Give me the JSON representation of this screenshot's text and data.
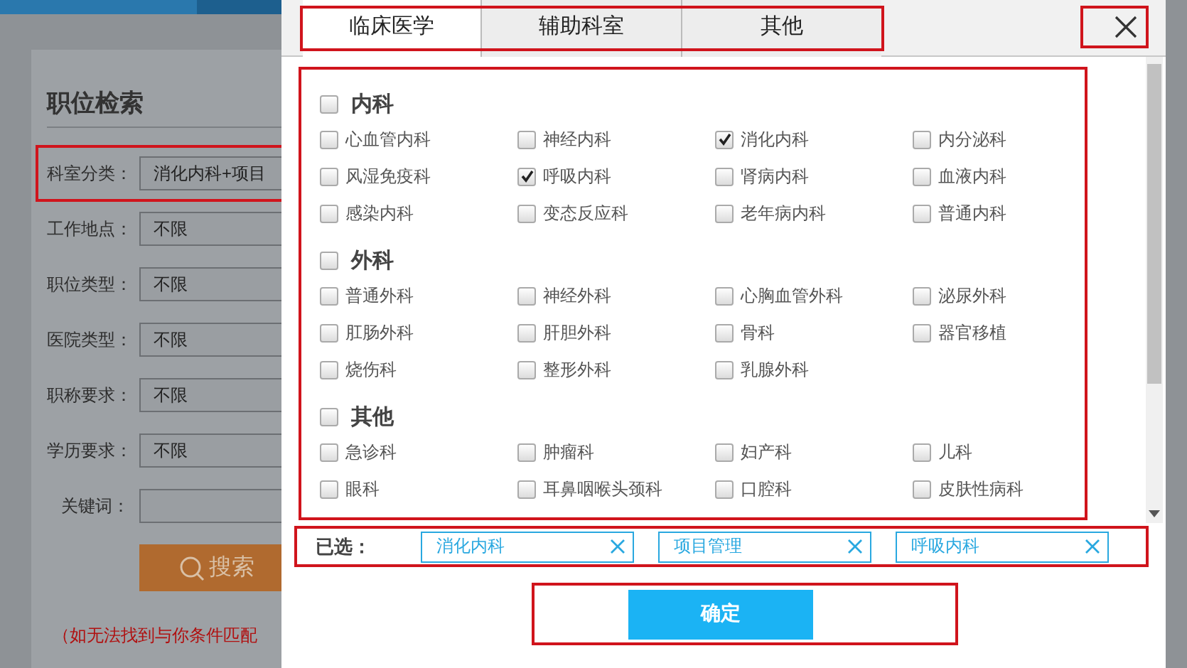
{
  "page": {
    "title": "职位检索",
    "fields": [
      {
        "label": "科室分类：",
        "value": "消化内科+项目"
      },
      {
        "label": "工作地点：",
        "value": "不限"
      },
      {
        "label": "职位类型：",
        "value": "不限"
      },
      {
        "label": "医院类型：",
        "value": "不限"
      },
      {
        "label": "职称要求：",
        "value": "不限"
      },
      {
        "label": "学历要求：",
        "value": "不限"
      },
      {
        "label": "关键词："
      }
    ],
    "search_button": "搜索",
    "note": "（如无法找到与你条件匹配"
  },
  "dialog": {
    "tabs": [
      {
        "label": "临床医学",
        "selected": true
      },
      {
        "label": "辅助科室",
        "selected": false
      },
      {
        "label": "其他",
        "selected": false
      }
    ],
    "groups": [
      {
        "title": "内科",
        "checked": false,
        "items": [
          {
            "label": "心血管内科",
            "checked": false
          },
          {
            "label": "神经内科",
            "checked": false
          },
          {
            "label": "消化内科",
            "checked": true
          },
          {
            "label": "内分泌科",
            "checked": false
          },
          {
            "label": "风湿免疫科",
            "checked": false
          },
          {
            "label": "呼吸内科",
            "checked": true
          },
          {
            "label": "肾病内科",
            "checked": false
          },
          {
            "label": "血液内科",
            "checked": false
          },
          {
            "label": "感染内科",
            "checked": false
          },
          {
            "label": "变态反应科",
            "checked": false
          },
          {
            "label": "老年病内科",
            "checked": false
          },
          {
            "label": "普通内科",
            "checked": false
          }
        ]
      },
      {
        "title": "外科",
        "checked": false,
        "items": [
          {
            "label": "普通外科",
            "checked": false
          },
          {
            "label": "神经外科",
            "checked": false
          },
          {
            "label": "心胸血管外科",
            "checked": false
          },
          {
            "label": "泌尿外科",
            "checked": false
          },
          {
            "label": "肛肠外科",
            "checked": false
          },
          {
            "label": "肝胆外科",
            "checked": false
          },
          {
            "label": "骨科",
            "checked": false
          },
          {
            "label": "器官移植",
            "checked": false
          },
          {
            "label": "烧伤科",
            "checked": false
          },
          {
            "label": "整形外科",
            "checked": false
          },
          {
            "label": "乳腺外科",
            "checked": false
          }
        ]
      },
      {
        "title": "其他",
        "checked": false,
        "items": [
          {
            "label": "急诊科",
            "checked": false
          },
          {
            "label": "肿瘤科",
            "checked": false
          },
          {
            "label": "妇产科",
            "checked": false
          },
          {
            "label": "儿科",
            "checked": false
          },
          {
            "label": "眼科",
            "checked": false
          },
          {
            "label": "耳鼻咽喉头颈科",
            "checked": false
          },
          {
            "label": "口腔科",
            "checked": false
          },
          {
            "label": "皮肤性病科",
            "checked": false
          }
        ]
      }
    ],
    "selected_label": "已选：",
    "selected_tags": [
      "消化内科",
      "项目管理",
      "呼吸内科"
    ],
    "confirm_button": "确定"
  }
}
